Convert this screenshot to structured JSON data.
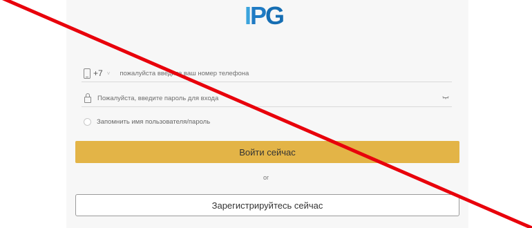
{
  "logo": {
    "letter_1": "I",
    "letter_2": "P",
    "letter_3": "G"
  },
  "phone_field": {
    "icon": "phone-icon",
    "country_code": "+7",
    "caret": "˅",
    "placeholder": "пожалуйста введите ваш номер телефона",
    "value": ""
  },
  "password_field": {
    "icon": "lock-icon",
    "placeholder": "Пожалуйста, введите пароль для входа",
    "value": "",
    "toggle_icon": "eye-closed-icon"
  },
  "remember": {
    "label": "Запомнить имя пользователя/пароль",
    "checked": false
  },
  "login_button": {
    "label": "Войти сейчас"
  },
  "separator": {
    "text": "or"
  },
  "register_button": {
    "label": "Зарегистрируйтесь сейчас"
  },
  "colors": {
    "login_button_bg": "#e3b447",
    "logo_light_blue": "#3ba4dd",
    "logo_dark_blue": "#166eb3",
    "strike_line": "#e8000b"
  },
  "overlay": {
    "type": "diagonal-strike-line"
  }
}
